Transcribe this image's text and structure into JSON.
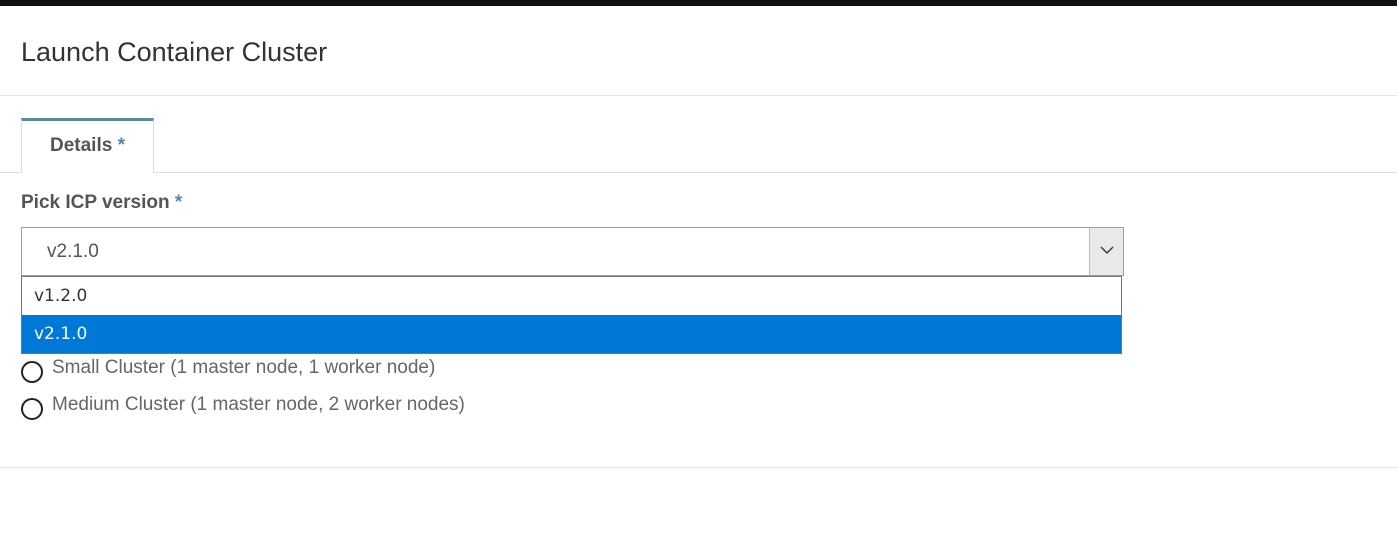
{
  "modal": {
    "title": "Launch Container Cluster"
  },
  "tabs": [
    {
      "label": "Details",
      "required_marker": "*"
    }
  ],
  "form": {
    "icp_version": {
      "label": "Pick ICP version",
      "required_marker": "*",
      "selected_value": "v2.1.0",
      "options": [
        {
          "label": "v1.2.0",
          "selected": false
        },
        {
          "label": "v2.1.0",
          "selected": true
        }
      ]
    },
    "cluster_size_options": [
      {
        "label": "Small Cluster (1 master node, 1 worker node)",
        "checked": false
      },
      {
        "label": "Medium Cluster (1 master node, 2 worker nodes)",
        "checked": false
      }
    ]
  },
  "icons": {
    "select_arrow": "chevron-down-icon"
  },
  "colors": {
    "tab_accent": "#5b8a9a",
    "required_marker": "#4f86b8",
    "option_highlight": "#0078d7"
  }
}
